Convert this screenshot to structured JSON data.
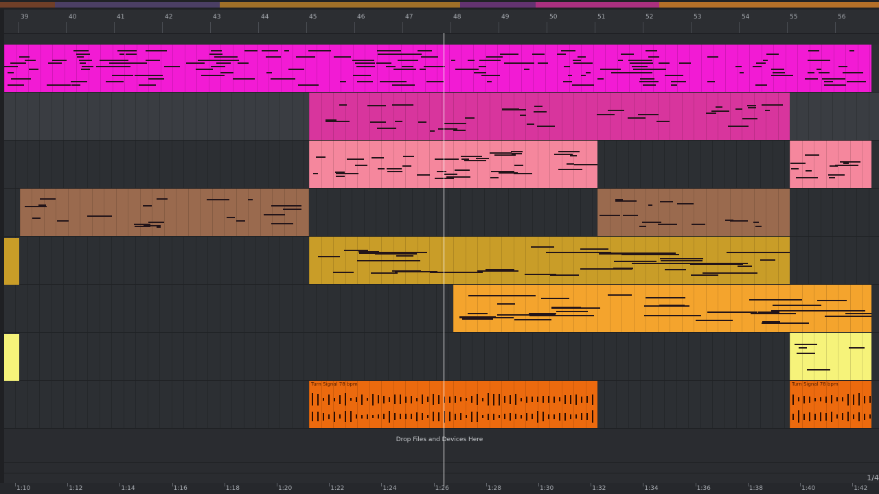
{
  "ruler": {
    "bars": [
      "39",
      "40",
      "41",
      "42",
      "43",
      "44",
      "45",
      "46",
      "47",
      "48",
      "49",
      "50",
      "51",
      "52",
      "53",
      "54",
      "55",
      "56"
    ]
  },
  "timeline": {
    "labels": [
      "1:10",
      "1:12",
      "1:14",
      "1:16",
      "1:18",
      "1:20",
      "1:22",
      "1:24",
      "1:26",
      "1:28",
      "1:30",
      "1:32",
      "1:34",
      "1:36",
      "1:38",
      "1:40",
      "1:42"
    ]
  },
  "tracks": [
    {
      "color": "#f21bd4",
      "empty": "#2c2f33"
    },
    {
      "color": "#d8359d",
      "empty": "#3a3d42"
    },
    {
      "color": "#f5879d",
      "empty": "#2c2f33"
    },
    {
      "color": "#9a6a4e",
      "empty": "#2c2f33"
    },
    {
      "color": "#c99d28",
      "empty": "#2c2f33"
    },
    {
      "color": "#f4a42d",
      "empty": "#2c2f33"
    },
    {
      "color": "#f6f37a",
      "empty": "#2c2f33"
    },
    {
      "color": "#ec6a0e",
      "empty": "#2c2f33"
    }
  ],
  "clips": {
    "audio_clip_name": "Turn Signal 78 bpm"
  },
  "drop_zone": {
    "text": "Drop Files and Devices Here"
  },
  "zoom_label": "1/4"
}
